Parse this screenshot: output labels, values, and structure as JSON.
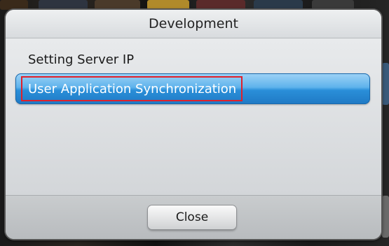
{
  "dialog": {
    "title": "Development",
    "items": [
      {
        "label": "Setting Server IP",
        "selected": false
      },
      {
        "label": "User Application Synchronization",
        "selected": true
      }
    ],
    "close_label": "Close"
  },
  "colors": {
    "selection_blue": "#2a8fd9",
    "highlight_red": "#e0202a"
  }
}
